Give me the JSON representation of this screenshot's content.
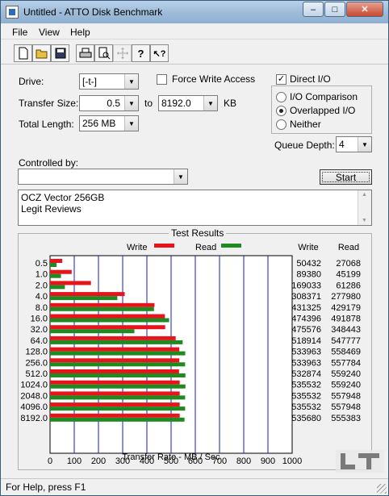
{
  "window": {
    "title": "Untitled - ATTO Disk Benchmark"
  },
  "titlebar_buttons": {
    "minimize": "–",
    "maximize": "□",
    "close": "✕"
  },
  "menu": [
    "File",
    "View",
    "Help"
  ],
  "toolbar": {
    "buttons": [
      {
        "name": "new-icon",
        "glyph": "🗋"
      },
      {
        "name": "open-icon",
        "glyph": "📂"
      },
      {
        "name": "save-icon",
        "glyph": "💾"
      },
      {
        "name": "print-icon",
        "glyph": "🖶"
      },
      {
        "name": "print-preview-icon",
        "glyph": "🔍"
      },
      {
        "name": "move-icon",
        "glyph": "✥"
      },
      {
        "name": "help-icon",
        "glyph": "?"
      },
      {
        "name": "context-help-icon",
        "glyph": "↖?"
      }
    ]
  },
  "form": {
    "drive_label": "Drive:",
    "drive_value": "[-t-]",
    "transfer_size_label": "Transfer Size:",
    "transfer_from": "0.5",
    "to_label": "to",
    "transfer_to": "8192.0",
    "kb_label": "KB",
    "total_length_label": "Total Length:",
    "total_length": "256 MB",
    "force_write_label": "Force Write Access",
    "force_write_checked": false,
    "direct_io_label": "Direct I/O",
    "direct_io_checked": true,
    "io_comparison_label": "I/O Comparison",
    "overlapped_io_label": "Overlapped I/O",
    "neither_label": "Neither",
    "selected_mode": "overlapped",
    "queue_depth_label": "Queue Depth:",
    "queue_depth": "4",
    "controlled_by_label": "Controlled by:",
    "controlled_by_value": "",
    "start_label": "Start"
  },
  "description": [
    "OCZ Vector 256GB",
    "Legit Reviews"
  ],
  "results": {
    "title": "Test Results",
    "write_legend": "Write",
    "read_legend": "Read",
    "write_col": "Write",
    "read_col": "Read",
    "xlabel": "Transfer Rate - MB / Sec"
  },
  "status": "For Help, press F1",
  "chart_data": {
    "type": "bar",
    "categories": [
      "0.5",
      "1.0",
      "2.0",
      "4.0",
      "8.0",
      "16.0",
      "32.0",
      "64.0",
      "128.0",
      "256.0",
      "512.0",
      "1024.0",
      "2048.0",
      "4096.0",
      "8192.0"
    ],
    "xlabel": "Transfer Rate - MB / Sec",
    "xlim": [
      0,
      1000
    ],
    "xticks": [
      "0",
      "100",
      "200",
      "300",
      "400",
      "500",
      "600",
      "700",
      "800",
      "900",
      "1000"
    ],
    "legend": "top",
    "grid": true,
    "series": [
      {
        "name": "Write",
        "color": "#e8141c",
        "values": [
          50432,
          89380,
          169033,
          308371,
          431325,
          474396,
          475576,
          518914,
          533963,
          533963,
          532874,
          535532,
          535532,
          535532,
          535680
        ]
      },
      {
        "name": "Read",
        "color": "#1f8a1f",
        "values": [
          27068,
          45199,
          61286,
          277980,
          429179,
          491878,
          348443,
          547777,
          558469,
          557784,
          559240,
          559240,
          557948,
          557948,
          555383
        ]
      }
    ]
  }
}
